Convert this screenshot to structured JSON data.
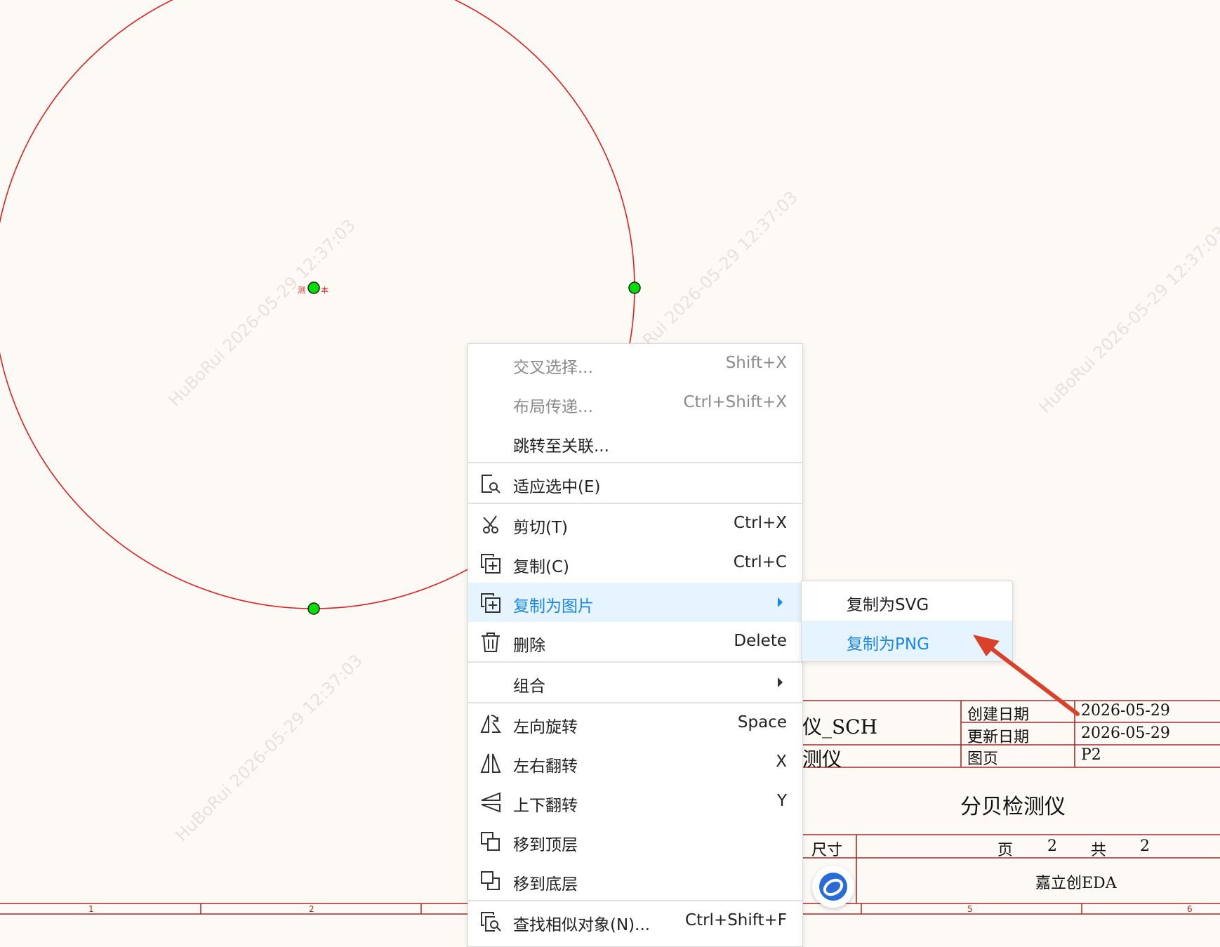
{
  "canvas": {
    "label_left": "测",
    "label_right": "本",
    "watermark": "HuBoRui 2026-05-29 12:37:03"
  },
  "ruler": {
    "numbers": [
      "1",
      "2",
      "5",
      "6"
    ]
  },
  "context_menu": {
    "items": [
      {
        "label": "交叉选择...",
        "shortcut": "Shift+X",
        "disabled": true
      },
      {
        "label": "布局传递...",
        "shortcut": "Ctrl+Shift+X",
        "disabled": true
      },
      {
        "label": "跳转至关联...",
        "shortcut": ""
      },
      {
        "label": "适应选中(E)",
        "shortcut": "",
        "icon": "fit-selection-icon"
      },
      {
        "label": "剪切(T)",
        "shortcut": "Ctrl+X",
        "icon": "scissors-icon"
      },
      {
        "label": "复制(C)",
        "shortcut": "Ctrl+C",
        "icon": "copy-icon"
      },
      {
        "label": "复制为图片",
        "shortcut": "",
        "icon": "copy-image-icon",
        "active": true,
        "submenu": true
      },
      {
        "label": "删除",
        "shortcut": "Delete",
        "icon": "trash-icon"
      },
      {
        "label": "组合",
        "shortcut": "",
        "submenu": true
      },
      {
        "label": "左向旋转",
        "shortcut": "Space",
        "icon": "rotate-left-icon"
      },
      {
        "label": "左右翻转",
        "shortcut": "X",
        "icon": "flip-horizontal-icon"
      },
      {
        "label": "上下翻转",
        "shortcut": "Y",
        "icon": "flip-vertical-icon"
      },
      {
        "label": "移到顶层",
        "shortcut": "",
        "icon": "bring-to-front-icon"
      },
      {
        "label": "移到底层",
        "shortcut": "",
        "icon": "send-to-back-icon"
      },
      {
        "label": "查找相似对象(N)...",
        "shortcut": "Ctrl+Shift+F",
        "icon": "find-similar-icon"
      }
    ]
  },
  "submenu": {
    "items": [
      {
        "label": "复制为SVG"
      },
      {
        "label": "复制为PNG",
        "active": true
      }
    ]
  },
  "title_block": {
    "project_name_partial": "仪_SCH",
    "sheet_name_partial": "测仪",
    "create_date_label": "创建日期",
    "create_date": "2026-05-29",
    "update_date_label": "更新日期",
    "update_date": "2026-05-29",
    "page_label": "图页",
    "page_value": "P2",
    "title": "分贝检测仪",
    "size_label": "尺寸",
    "page_word": "页",
    "page_num": "2",
    "total_word": "共",
    "total_num": "2",
    "company": "嘉立创EDA"
  },
  "colors": {
    "background": "#fdfaf6",
    "circle_stroke": "#e02020",
    "border": "#a52a2a",
    "handle": "#00e000",
    "accent": "#1a86e6",
    "arrow": "#d9412a"
  }
}
